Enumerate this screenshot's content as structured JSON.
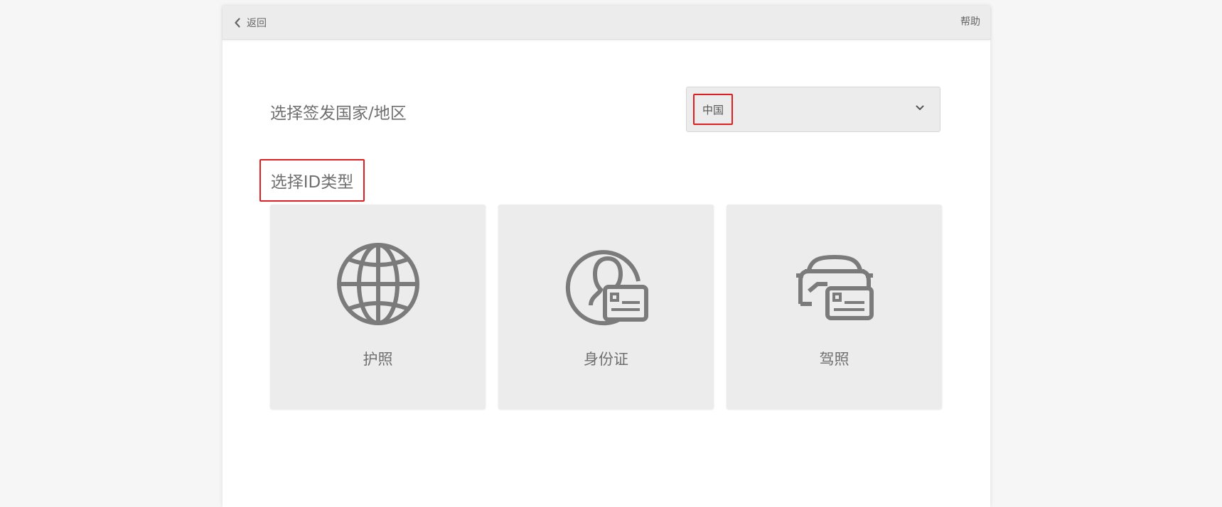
{
  "header": {
    "back_label": "返回",
    "help_label": "帮助"
  },
  "country": {
    "label": "选择签发国家/地区",
    "selected": "中国"
  },
  "id_type": {
    "label": "选择ID类型",
    "options": [
      {
        "label": "护照",
        "icon": "globe-icon"
      },
      {
        "label": "身份证",
        "icon": "id-card-icon"
      },
      {
        "label": "驾照",
        "icon": "car-license-icon"
      }
    ]
  },
  "colors": {
    "background": "#f6f6f6",
    "panel": "#ffffff",
    "topbar": "#ececec",
    "card": "#ececec",
    "text": "#6f6f6f",
    "highlight": "#e02020"
  }
}
